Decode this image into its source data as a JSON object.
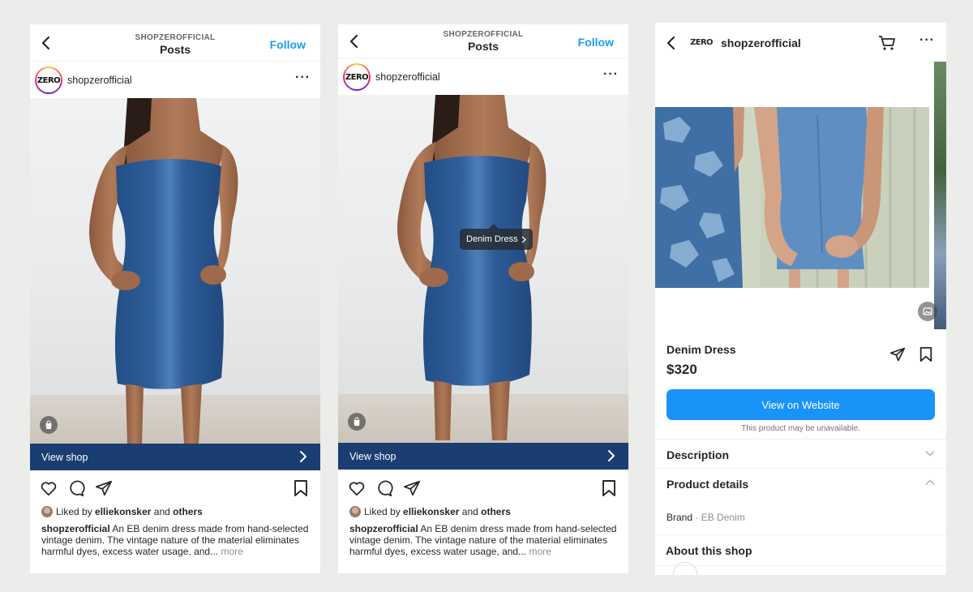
{
  "colors": {
    "follow_blue": "#1d9bf0",
    "view_shop_bar": "#1a3e72",
    "cta_blue": "#1893f8",
    "denim": "#2f5f9c"
  },
  "post_screen": {
    "header": {
      "kicker": "SHOPZEROFFICIAL",
      "title": "Posts",
      "follow": "Follow"
    },
    "account": {
      "avatar_text": "ZERO",
      "username": "shopzerofficial"
    },
    "view_shop": "View shop",
    "liked": {
      "prefix": "Liked by",
      "user": "elliekonsker",
      "and": "and",
      "others": "others"
    },
    "caption": {
      "username": "shopzerofficial",
      "text": "An EB denim dress made from hand-selected vintage denim. The vintage nature of the material eliminates harmful dyes, excess water usage, and...",
      "more": "more"
    },
    "product_tag": "Denim Dress",
    "icons": [
      "back-icon",
      "more-icon",
      "shopping-bag-icon",
      "chevron-right-icon",
      "heart-icon",
      "comment-icon",
      "share-icon",
      "bookmark-icon"
    ]
  },
  "product_screen": {
    "header": {
      "logo_text": "ZERO",
      "shop_name": "shopzerofficial"
    },
    "product": {
      "name": "Denim Dress",
      "price": "$320"
    },
    "cta": "View on Website",
    "cta_note": "This product may be unavailable.",
    "sections": {
      "description": "Description",
      "product_details": "Product details",
      "brand_label": "Brand",
      "brand_sep": "·",
      "brand_value": "EB Denim",
      "about_shop": "About this shop"
    },
    "icons": [
      "back-icon",
      "cart-icon",
      "more-icon",
      "gallery-icon",
      "share-icon",
      "bookmark-icon",
      "chevron-down-icon",
      "chevron-up-icon"
    ]
  }
}
